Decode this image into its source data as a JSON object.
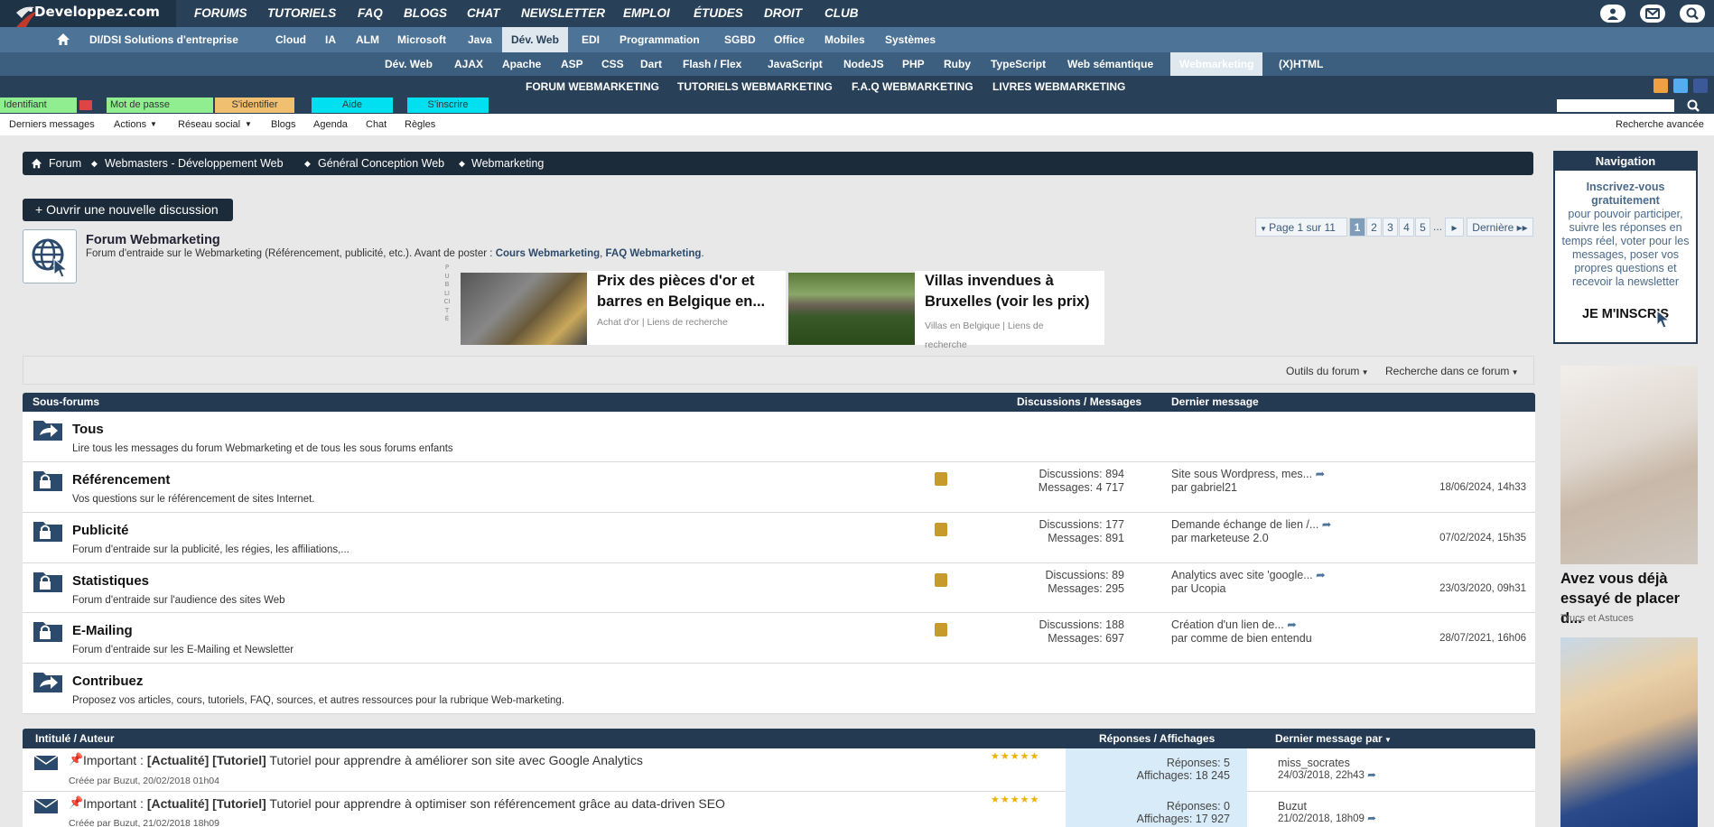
{
  "site": {
    "name": "Developpez.com"
  },
  "topnav": [
    "FORUMS",
    "TUTORIELS",
    "FAQ",
    "BLOGS",
    "CHAT",
    "NEWSLETTER",
    "EMPLOI",
    "ÉTUDES",
    "DROIT",
    "CLUB"
  ],
  "bar2": [
    "DI/DSI Solutions d'entreprise",
    "Cloud",
    "IA",
    "ALM",
    "Microsoft",
    "Java",
    "Dév. Web",
    "EDI",
    "Programmation",
    "SGBD",
    "Office",
    "Mobiles",
    "Systèmes"
  ],
  "bar3": [
    "Dév. Web",
    "AJAX",
    "Apache",
    "ASP",
    "CSS",
    "Dart",
    "Flash / Flex",
    "JavaScript",
    "NodeJS",
    "PHP",
    "Ruby",
    "TypeScript",
    "Web sémantique",
    "Webmarketing",
    "(X)HTML"
  ],
  "bar4": [
    "FORUM WEBMARKETING",
    "TUTORIELS WEBMARKETING",
    "F.A.Q WEBMARKETING",
    "LIVRES WEBMARKETING"
  ],
  "login": {
    "username": "Identifiant",
    "password": "Mot de passe",
    "login_btn": "S'identifier",
    "help": "Aide",
    "register": "S'inscrire"
  },
  "submenu": [
    "Derniers messages",
    "Actions",
    "Réseau social",
    "Blogs",
    "Agenda",
    "Chat",
    "Règles"
  ],
  "advanced_search": "Recherche avancée",
  "breadcrumb": [
    "Forum",
    "Webmasters - Développement Web",
    "Général Conception Web",
    "Webmarketing"
  ],
  "new_discussion": "+ Ouvrir une nouvelle discussion",
  "forum": {
    "title": "Forum Webmarketing",
    "desc": "Forum d'entraide sur le Webmarketing (Référencement, publicité, etc.). Avant de poster : ",
    "link1": "Cours Webmarketing",
    "link2": "FAQ Webmarketing",
    "sep": ", ",
    "end": "."
  },
  "pagination": {
    "label": "Page 1 sur 11",
    "pages": [
      "1",
      "2",
      "3",
      "4",
      "5",
      "..."
    ],
    "next": "▸",
    "last": "Dernière"
  },
  "ad_label": "PUBLICITÉ",
  "ads": [
    {
      "title_line1": "Prix des pièces d'or et",
      "title_line2": "barres en Belgique en...",
      "source": "Achat d'or | Liens de recherche"
    },
    {
      "title_line1": "Villas invendues à",
      "title_line2": "Bruxelles (voir les prix)",
      "source_line1": "Villas en Belgique | Liens de",
      "source_line2": "recherche"
    }
  ],
  "tools": {
    "forum_tools": "Outils du forum",
    "search_forum": "Recherche dans ce forum"
  },
  "subforums_header": {
    "col1": "Sous-forums",
    "col2": "Discussions / Messages",
    "col3": "Dernier message"
  },
  "subforums": [
    {
      "title": "Tous",
      "desc": "Lire tous les messages du forum Webmarketing et de tous les sous forums enfants"
    },
    {
      "title": "Référencement",
      "desc": "Vos questions sur le référencement de sites Internet.",
      "discussions": "Discussions: 894",
      "messages": "Messages: 4 717",
      "last_title": "Site sous Wordpress, mes...",
      "last_by": "par gabriel21",
      "date": "18/06/2024, 14h33"
    },
    {
      "title": "Publicité",
      "desc": "Forum d'entraide sur la publicité, les régies, les affiliations,...",
      "discussions": "Discussions: 177",
      "messages": "Messages: 891",
      "last_title": "Demande échange de lien /...",
      "last_by": "par marketeuse 2.0",
      "date": "07/02/2024, 15h35"
    },
    {
      "title": "Statistiques",
      "desc": "Forum d'entraide sur l'audience des sites Web",
      "discussions": "Discussions: 89",
      "messages": "Messages: 295",
      "last_title": "Analytics avec site 'google...",
      "last_by": "par Ucopia",
      "date": "23/03/2020, 09h31"
    },
    {
      "title": "E-Mailing",
      "desc": "Forum d'entraide sur les E-Mailing et Newsletter",
      "discussions": "Discussions: 188",
      "messages": "Messages: 697",
      "last_title": "Création d'un lien de...",
      "last_by": "par comme de bien entendu",
      "date": "28/07/2021, 16h06"
    },
    {
      "title": "Contribuez",
      "desc": "Proposez vos articles, cours, tutoriels, FAQ, sources, et autres ressources pour la rubrique Web-marketing."
    }
  ],
  "threads_header": {
    "col1": "Intitulé / Auteur",
    "col2": "Réponses / Affichages",
    "col3": "Dernier message par"
  },
  "threads": [
    {
      "prefix": "Important : ",
      "tags": "[Actualité] [Tutoriel]",
      "title": " Tutoriel pour apprendre à améliorer son site avec Google Analytics",
      "created": "Créée par Buzut, 20/02/2018 01h04",
      "replies": "Réponses: 5",
      "views": "Affichages: 18 245",
      "last_user": "miss_socrates",
      "last_date": "24/03/2018, 22h43"
    },
    {
      "prefix": "Important : ",
      "tags": "[Actualité] [Tutoriel]",
      "title": " Tutoriel pour apprendre à optimiser son référencement grâce au data-driven SEO",
      "created": "Créée par Buzut, 21/02/2018 18h09",
      "replies": "Réponses: 0",
      "views": "Affichages: 17 927",
      "last_user": "Buzut",
      "last_date": "21/02/2018, 18h09"
    }
  ],
  "navigation": {
    "title": "Navigation",
    "bold1": "Inscrivez-vous",
    "bold2": "gratuitement",
    "text": "pour pouvoir participer, suivre les réponses en temps réel, voter pour les messages, poser vos propres questions et recevoir la newsletter",
    "button": "JE M'INSCRIS"
  },
  "sidead": {
    "title": "Avez vous déjà essayé de placer d...",
    "source": "Trucs et Astuces"
  },
  "colors": {
    "topbar": "#284058",
    "bar2": "#4d7396",
    "bar3": "#3c5f80",
    "header": "#243a52"
  }
}
